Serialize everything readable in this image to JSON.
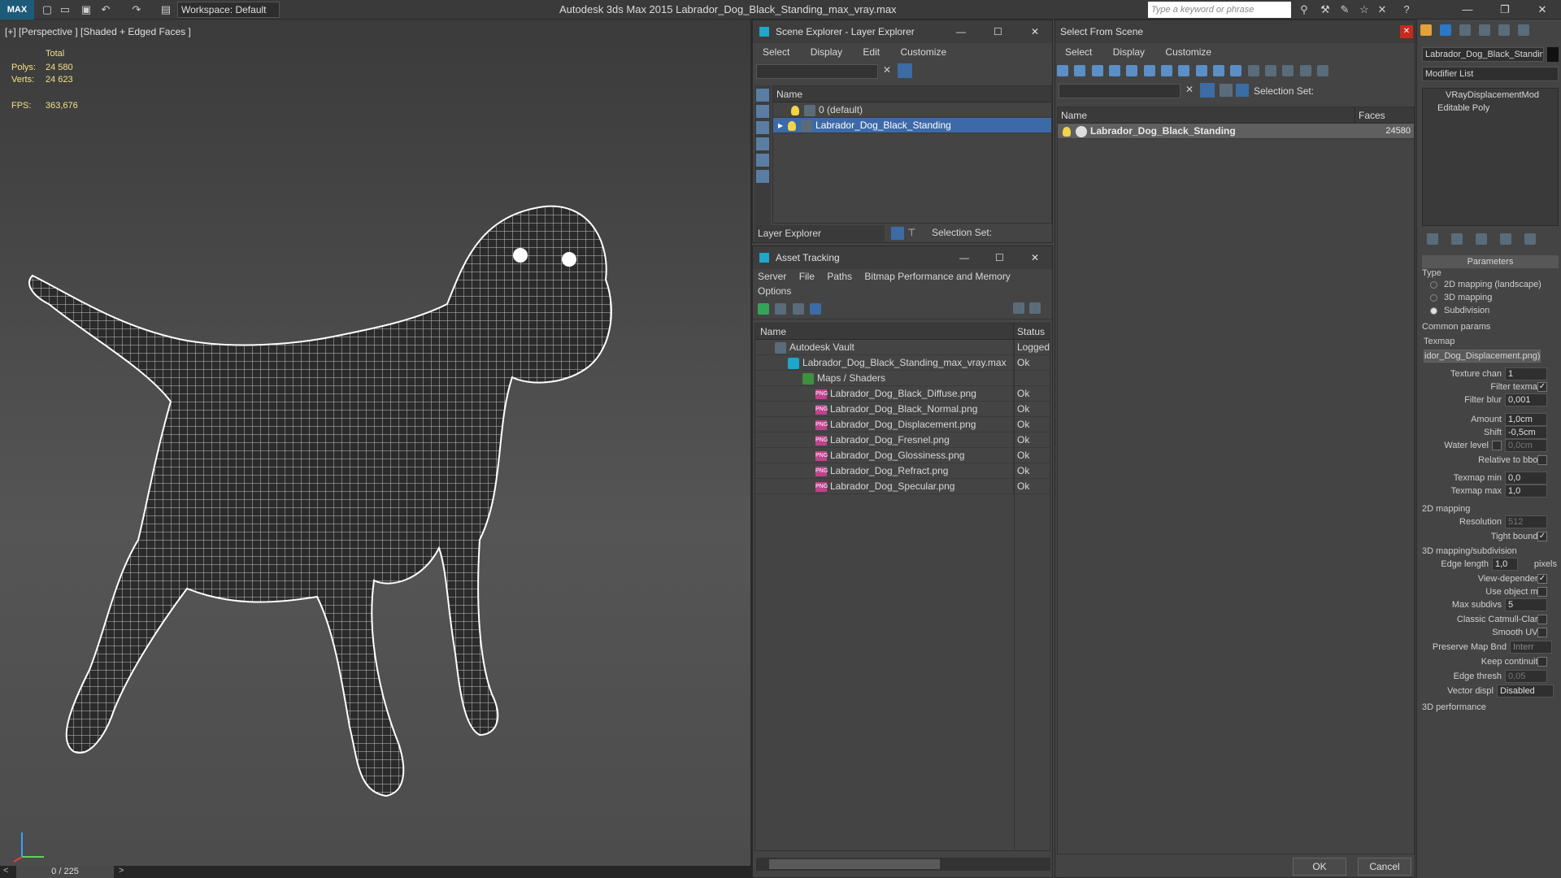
{
  "titlebar": {
    "logo": "MAX",
    "workspace": "Workspace: Default",
    "app_title": "Autodesk 3ds Max  2015    Labrador_Dog_Black_Standing_max_vray.max",
    "search_placeholder": "Type a keyword or phrase"
  },
  "viewport": {
    "label": "[+] [Perspective ] [Shaded + Edged Faces ]",
    "total_label": "Total",
    "polys_label": "Polys:",
    "polys_value": "24 580",
    "verts_label": "Verts:",
    "verts_value": "24 623",
    "fps_label": "FPS:",
    "fps_value": "363,676",
    "timeline": "0 / 225"
  },
  "scene_explorer": {
    "title": "Scene Explorer - Layer Explorer",
    "menu": [
      "Select",
      "Display",
      "Edit",
      "Customize"
    ],
    "col_name": "Name",
    "layers": [
      "0 (default)",
      "Labrador_Dog_Black_Standing"
    ],
    "footer_dropdown": "Layer Explorer",
    "selection_set": "Selection Set:"
  },
  "asset_tracking": {
    "title": "Asset Tracking",
    "menu": [
      "Server",
      "File",
      "Paths",
      "Bitmap Performance and Memory"
    ],
    "menu2": "Options",
    "col_name": "Name",
    "col_status": "Status",
    "rows": [
      {
        "name": "Autodesk Vault",
        "status": "Logged"
      },
      {
        "name": "Labrador_Dog_Black_Standing_max_vray.max",
        "status": "Ok"
      },
      {
        "name": "Maps / Shaders",
        "status": ""
      },
      {
        "name": "Labrador_Dog_Black_Diffuse.png",
        "status": "Ok"
      },
      {
        "name": "Labrador_Dog_Black_Normal.png",
        "status": "Ok"
      },
      {
        "name": "Labrador_Dog_Displacement.png",
        "status": "Ok"
      },
      {
        "name": "Labrador_Dog_Fresnel.png",
        "status": "Ok"
      },
      {
        "name": "Labrador_Dog_Glossiness.png",
        "status": "Ok"
      },
      {
        "name": "Labrador_Dog_Refract.png",
        "status": "Ok"
      },
      {
        "name": "Labrador_Dog_Specular.png",
        "status": "Ok"
      }
    ]
  },
  "select_from_scene": {
    "title": "Select From Scene",
    "menu": [
      "Select",
      "Display",
      "Customize"
    ],
    "selection_set": "Selection Set:",
    "col_name": "Name",
    "col_faces": "Faces",
    "row_name": "Labrador_Dog_Black_Standing",
    "row_faces": "24580",
    "ok": "OK",
    "cancel": "Cancel"
  },
  "command_panel": {
    "object_name": "Labrador_Dog_Black_Standin",
    "modifier_list": "Modifier List",
    "stack": [
      "VRayDisplacementMod",
      "Editable Poly"
    ],
    "rollout": "Parameters",
    "type_label": "Type",
    "types": [
      "2D mapping (landscape)",
      "3D mapping",
      "Subdivision"
    ],
    "common_params": "Common params",
    "texmap_label": "Texmap",
    "texmap_value": "idor_Dog_Displacement.png)",
    "texture_chan_label": "Texture chan",
    "texture_chan_value": "1",
    "filter_texmap": "Filter texmap",
    "filter_blur_label": "Filter blur",
    "filter_blur_value": "0,001",
    "amount_label": "Amount",
    "amount_value": "1,0cm",
    "shift_label": "Shift",
    "shift_value": "-0,5cm",
    "water_level_label": "Water level",
    "water_level_value": "0,0cm",
    "relative_to_bbox": "Relative to bbox",
    "texmap_min_label": "Texmap min",
    "texmap_min_value": "0,0",
    "texmap_max_label": "Texmap max",
    "texmap_max_value": "1,0",
    "mapping2d": "2D mapping",
    "resolution_label": "Resolution",
    "resolution_value": "512",
    "tight_bounds": "Tight bounds",
    "mapping3d": "3D mapping/subdivision",
    "edge_length_label": "Edge length",
    "edge_length_value": "1,0",
    "pixels": "pixels",
    "view_dependent": "View-dependent",
    "use_object_mtl": "Use object mtl",
    "max_subdivs_label": "Max subdivs",
    "max_subdivs_value": "5",
    "classic_catmull": "Classic Catmull-Clark",
    "smooth_uvs": "Smooth UVs",
    "preserve_map_bnd": "Preserve Map Bnd",
    "preserve_value": "Interr",
    "keep_continuity": "Keep continuity",
    "edge_thresh_label": "Edge thresh",
    "edge_thresh_value": "0,05",
    "vector_displ_label": "Vector displ",
    "vector_displ_value": "Disabled",
    "perf": "3D performance"
  }
}
